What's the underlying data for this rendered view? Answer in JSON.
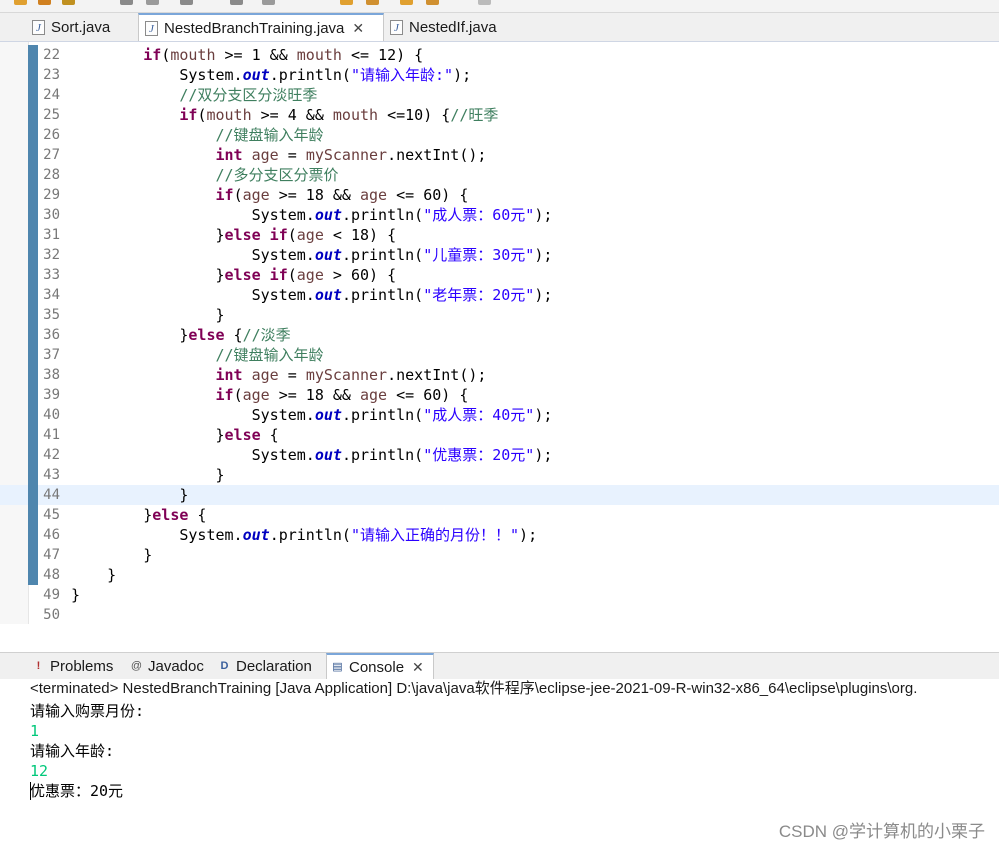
{
  "editor_tabs": [
    {
      "label": "Sort.java",
      "active": false
    },
    {
      "label": "NestedBranchTraining.java",
      "active": true
    },
    {
      "label": "NestedIf.java",
      "active": false
    }
  ],
  "current_line": 44,
  "code_lines": [
    {
      "n": 22,
      "html": "        <span class='kw'>if</span>(<span class='var'>mouth</span> >= 1 && <span class='var'>mouth</span> <= 12) {"
    },
    {
      "n": 23,
      "html": "            System.<span class='fld'>out</span>.println(<span class='str'>\"请输入年龄:\"</span>);"
    },
    {
      "n": 24,
      "html": "            <span class='cmt'>//双分支区分淡旺季</span>"
    },
    {
      "n": 25,
      "html": "            <span class='kw'>if</span>(<span class='var'>mouth</span> >= 4 && <span class='var'>mouth</span> <=10) {<span class='cmt'>//旺季</span>"
    },
    {
      "n": 26,
      "html": "                <span class='cmt'>//键盘输入年龄</span>"
    },
    {
      "n": 27,
      "html": "                <span class='kw'>int</span> <span class='var'>age</span> = <span class='var'>myScanner</span>.nextInt();"
    },
    {
      "n": 28,
      "html": "                <span class='cmt'>//多分支区分票价</span>"
    },
    {
      "n": 29,
      "html": "                <span class='kw'>if</span>(<span class='var'>age</span> >= 18 && <span class='var'>age</span> <= 60) {"
    },
    {
      "n": 30,
      "html": "                    System.<span class='fld'>out</span>.println(<span class='str'>\"成人票：60元\"</span>);"
    },
    {
      "n": 31,
      "html": "                }<span class='kw'>else if</span>(<span class='var'>age</span> < 18) {"
    },
    {
      "n": 32,
      "html": "                    System.<span class='fld'>out</span>.println(<span class='str'>\"儿童票：30元\"</span>);"
    },
    {
      "n": 33,
      "html": "                }<span class='kw'>else if</span>(<span class='var'>age</span> > 60) {"
    },
    {
      "n": 34,
      "html": "                    System.<span class='fld'>out</span>.println(<span class='str'>\"老年票：20元\"</span>);"
    },
    {
      "n": 35,
      "html": "                }"
    },
    {
      "n": 36,
      "html": "            }<span class='kw'>else</span> {<span class='cmt'>//淡季</span>"
    },
    {
      "n": 37,
      "html": "                <span class='cmt'>//键盘输入年龄</span>"
    },
    {
      "n": 38,
      "html": "                <span class='kw'>int</span> <span class='var'>age</span> = <span class='var'>myScanner</span>.nextInt();"
    },
    {
      "n": 39,
      "html": "                <span class='kw'>if</span>(<span class='var'>age</span> >= 18 && <span class='var'>age</span> <= 60) {"
    },
    {
      "n": 40,
      "html": "                    System.<span class='fld'>out</span>.println(<span class='str'>\"成人票：40元\"</span>);"
    },
    {
      "n": 41,
      "html": "                }<span class='kw'>else</span> {"
    },
    {
      "n": 42,
      "html": "                    System.<span class='fld'>out</span>.println(<span class='str'>\"优惠票：20元\"</span>);"
    },
    {
      "n": 43,
      "html": "                }"
    },
    {
      "n": 44,
      "html": "            }"
    },
    {
      "n": 45,
      "html": "        }<span class='kw'>else</span> {"
    },
    {
      "n": 46,
      "html": "            System.<span class='fld'>out</span>.println(<span class='str'>\"请输入正确的月份！！\"</span>);"
    },
    {
      "n": 47,
      "html": "        }"
    },
    {
      "n": 48,
      "html": "    }"
    },
    {
      "n": 49,
      "html": "}"
    },
    {
      "n": 50,
      "html": ""
    }
  ],
  "panel_tabs": [
    {
      "label": "Problems",
      "icon": "problems-icon",
      "glyph": "!",
      "color": "#b03030",
      "active": false
    },
    {
      "label": "Javadoc",
      "icon": "javadoc-icon",
      "glyph": "@",
      "color": "#555555",
      "active": false
    },
    {
      "label": "Declaration",
      "icon": "declaration-icon",
      "glyph": "D",
      "color": "#3a5f9c",
      "active": false
    },
    {
      "label": "Console",
      "icon": "console-icon",
      "glyph": "▤",
      "color": "#2a4f8a",
      "active": true
    }
  ],
  "console": {
    "terminated_line": "<terminated> NestedBranchTraining [Java Application] D:\\java\\java软件程序\\eclipse-jee-2021-09-R-win32-x86_64\\eclipse\\plugins\\org.",
    "lines": [
      {
        "text": "请输入购票月份:",
        "input": false
      },
      {
        "text": "1",
        "input": true
      },
      {
        "text": "请输入年龄:",
        "input": false
      },
      {
        "text": "12",
        "input": true
      },
      {
        "text": "优惠票：20元",
        "input": false
      }
    ]
  },
  "watermark": "CSDN @学计算机的小栗子"
}
